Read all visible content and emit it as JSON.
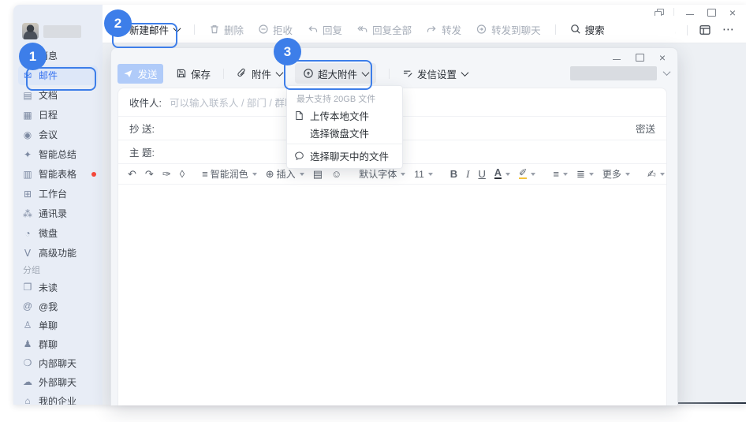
{
  "colors": {
    "annotation_accent": "#3d7ee9",
    "selected_blue": "#3370f0",
    "send_disabled_bg": "#b0cbf9",
    "red_dot": "#f5483b",
    "sidebar_bg": "#e8edf6"
  },
  "annotations": {
    "badges": [
      "1",
      "2",
      "3"
    ]
  },
  "window": {
    "close": "×"
  },
  "sidebar": {
    "nav": [
      {
        "icon": "▣",
        "label": "消息"
      },
      {
        "icon": "✉",
        "label": "邮件"
      },
      {
        "icon": "▤",
        "label": "文档"
      },
      {
        "icon": "▦",
        "label": "日程"
      },
      {
        "icon": "◉",
        "label": "会议"
      },
      {
        "icon": "✦",
        "label": "智能总结"
      },
      {
        "icon": "▥",
        "label": "智能表格"
      },
      {
        "icon": "⊞",
        "label": "工作台"
      },
      {
        "icon": "⁂",
        "label": "通讯录"
      },
      {
        "icon": "◔",
        "label": "微盘"
      },
      {
        "icon": "Ⅴ",
        "label": "高级功能"
      }
    ],
    "group_label": "分组",
    "groups": [
      {
        "icon": "❐",
        "label": "未读"
      },
      {
        "icon": "@",
        "label": "@我"
      },
      {
        "icon": "♙",
        "label": "单聊"
      },
      {
        "icon": "♟",
        "label": "群聊"
      },
      {
        "icon": "❍",
        "label": "内部聊天"
      },
      {
        "icon": "☁",
        "label": "外部聊天"
      },
      {
        "icon": "⌂",
        "label": "我的企业"
      }
    ]
  },
  "toolbar": {
    "new_mail": "新建邮件",
    "delete": "删除",
    "reject": "拒收",
    "reply": "回复",
    "reply_all": "回复全部",
    "forward": "转发",
    "forward_chat": "转发到聊天",
    "search": "搜索"
  },
  "compose": {
    "send": "发送",
    "save": "保存",
    "attach": "附件",
    "big_attach": "超大附件",
    "send_settings": "发信设置",
    "menu": {
      "header": "最大支持 20GB 文件",
      "items": [
        "上传本地文件",
        "选择微盘文件",
        "选择聊天中的文件"
      ]
    },
    "fields": {
      "to_label": "收件人:",
      "to_placeholder": "可以输入联系人 / 部门 / 群聊",
      "cc_label": "抄 送:",
      "bcc": "密送",
      "subject_label": "主 题:"
    },
    "editor": {
      "icons": {
        "undo": "↶",
        "redo": "↷",
        "painter": "✑",
        "eraser": "◊",
        "polish_icon": "≡",
        "insert_icon": "⊕",
        "card": "▤",
        "emoji": "☺",
        "align": "≡",
        "list": "≣",
        "sign": "✍",
        "pen": "✐"
      },
      "polish": "智能润色",
      "insert": "插入",
      "font": "默认字体",
      "size": "11",
      "bold": "B",
      "italic": "I",
      "underline": "U",
      "color": "A",
      "more": "更多"
    }
  }
}
